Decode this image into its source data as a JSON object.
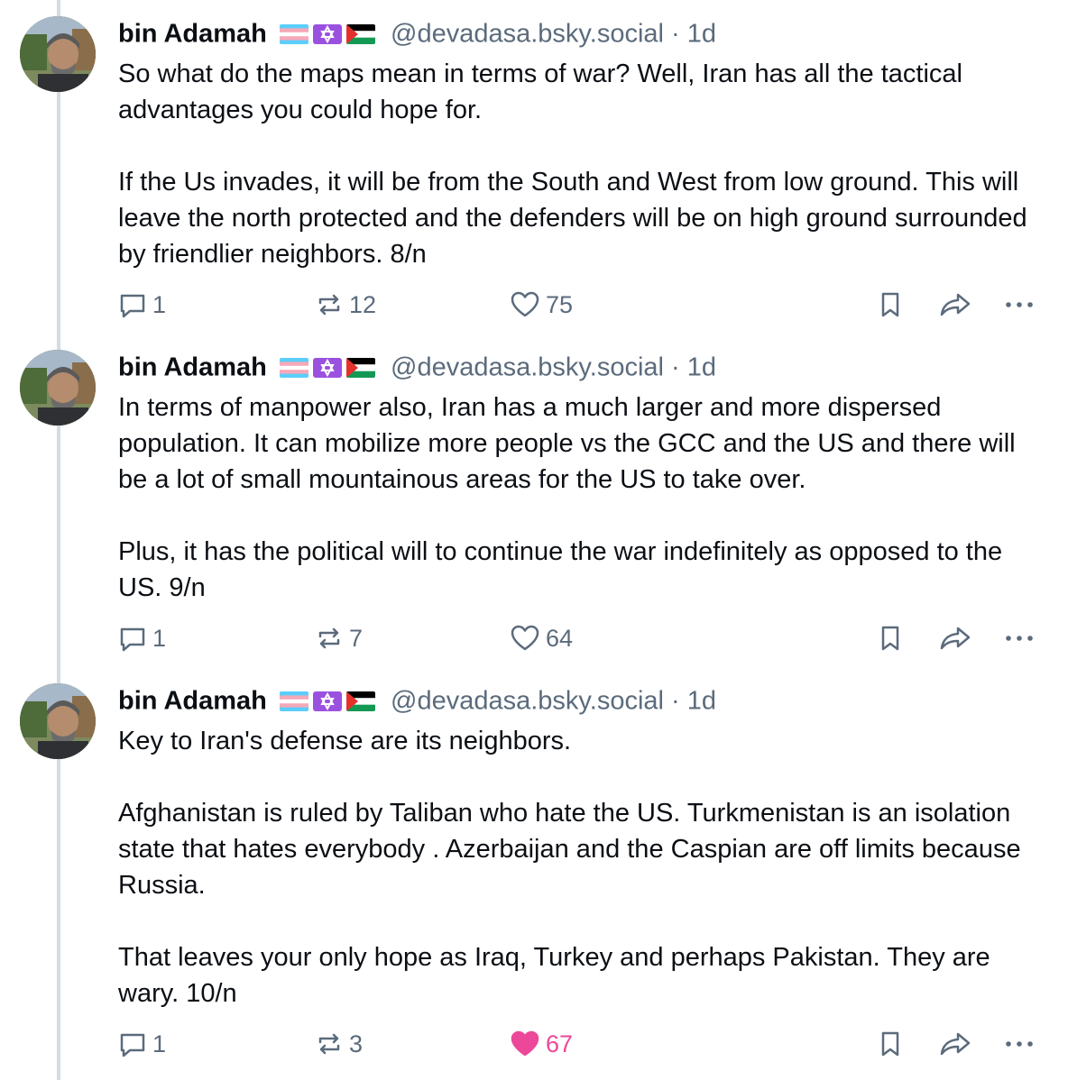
{
  "posts": [
    {
      "author": "bin Adamah",
      "handle": "@devadasa.bsky.social",
      "time": "· 1d",
      "paragraphs": [
        "So what do the maps mean in terms of war? Well, Iran has all the tactical advantages you could hope for.",
        "If the Us invades, it will be from the South and West from low ground. This will leave the north protected and the defenders will be on high ground surrounded by friendlier neighbors. 8/n"
      ],
      "replies": "1",
      "reposts": "12",
      "likes": "75",
      "liked": false
    },
    {
      "author": "bin Adamah",
      "handle": "@devadasa.bsky.social",
      "time": "· 1d",
      "paragraphs": [
        "In terms of manpower also, Iran has a much larger and more dispersed population. It can mobilize more people vs the GCC and the US and there will be a lot of small mountainous areas for the US to take over.",
        "Plus, it has the political will to continue the war indefinitely as opposed to the US. 9/n"
      ],
      "replies": "1",
      "reposts": "7",
      "likes": "64",
      "liked": false
    },
    {
      "author": "bin Adamah",
      "handle": "@devadasa.bsky.social",
      "time": "· 1d",
      "paragraphs": [
        "Key to Iran's defense are its neighbors.",
        "Afghanistan is ruled by Taliban who hate the US. Turkmenistan is an isolation state that hates everybody . Azerbaijan and the Caspian are off limits because Russia.",
        "That leaves your only hope as Iraq, Turkey and perhaps Pakistan. They are wary. 10/n"
      ],
      "replies": "1",
      "reposts": "3",
      "likes": "67",
      "liked": true
    }
  ],
  "icons": [
    "reply-icon",
    "repost-icon",
    "like-icon",
    "bookmark-icon",
    "share-icon",
    "more-icon"
  ],
  "colors": {
    "muted": "#5b6b7c",
    "liked": "#ec4899",
    "thread_line": "#d4dbe2"
  }
}
